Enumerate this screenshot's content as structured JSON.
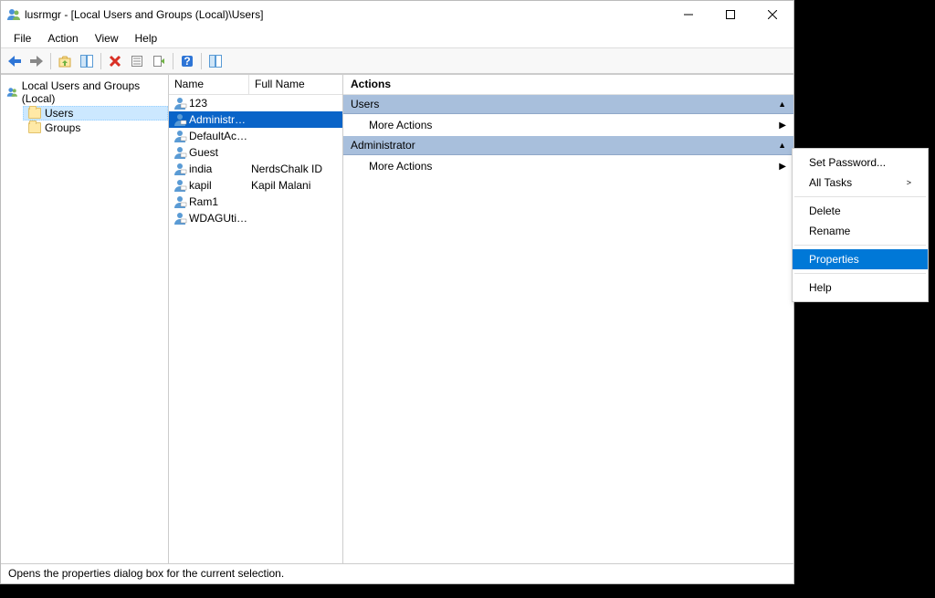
{
  "window": {
    "title": "lusrmgr - [Local Users and Groups (Local)\\Users]"
  },
  "menubar": [
    "File",
    "Action",
    "View",
    "Help"
  ],
  "tree": {
    "root": "Local Users and Groups (Local)",
    "items": [
      {
        "label": "Users",
        "selected": true
      },
      {
        "label": "Groups",
        "selected": false
      }
    ]
  },
  "list": {
    "headers": {
      "name": "Name",
      "fullname": "Full Name"
    },
    "rows": [
      {
        "name": "123",
        "fullname": "",
        "selected": false
      },
      {
        "name": "Administrator",
        "fullname": "",
        "selected": true
      },
      {
        "name": "DefaultAcco...",
        "fullname": "",
        "selected": false
      },
      {
        "name": "Guest",
        "fullname": "",
        "selected": false
      },
      {
        "name": "india",
        "fullname": "NerdsChalk ID",
        "selected": false
      },
      {
        "name": "kapil",
        "fullname": "Kapil Malani",
        "selected": false
      },
      {
        "name": "Ram1",
        "fullname": "",
        "selected": false
      },
      {
        "name": "WDAGUtility...",
        "fullname": "",
        "selected": false
      }
    ]
  },
  "actions": {
    "title": "Actions",
    "sections": [
      {
        "header": "Users",
        "items": [
          {
            "label": "More Actions",
            "hasSub": true
          }
        ]
      },
      {
        "header": "Administrator",
        "items": [
          {
            "label": "More Actions",
            "hasSub": true
          }
        ]
      }
    ]
  },
  "context_menu": {
    "items": [
      {
        "label": "Set Password...",
        "type": "item"
      },
      {
        "label": "All Tasks",
        "type": "submenu"
      },
      {
        "type": "separator"
      },
      {
        "label": "Delete",
        "type": "item"
      },
      {
        "label": "Rename",
        "type": "item"
      },
      {
        "type": "separator"
      },
      {
        "label": "Properties",
        "type": "item",
        "highlighted": true
      },
      {
        "type": "separator"
      },
      {
        "label": "Help",
        "type": "item"
      }
    ]
  },
  "statusbar": "Opens the properties dialog box for the current selection."
}
